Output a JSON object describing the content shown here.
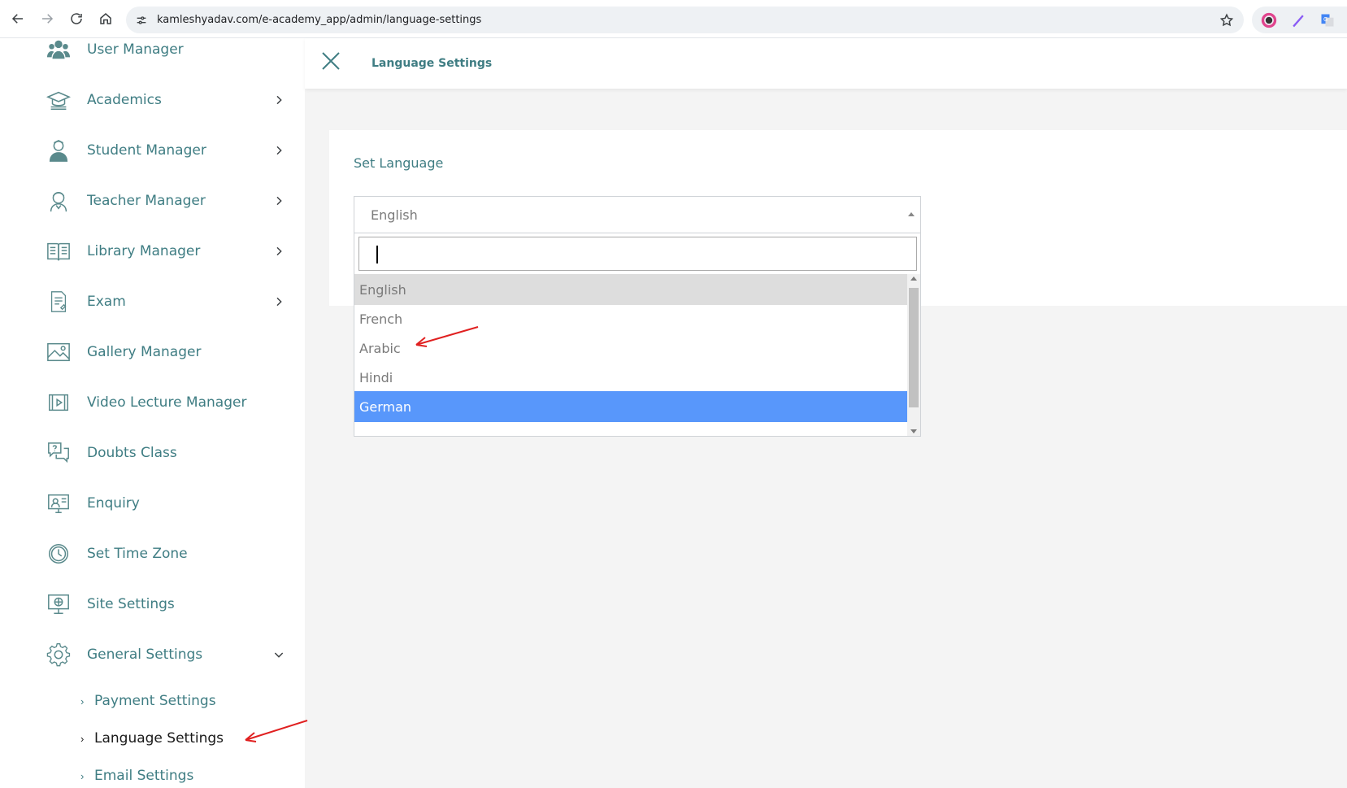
{
  "browser": {
    "url": "kamleshyadav.com/e-academy_app/admin/language-settings"
  },
  "sidebar": {
    "items": [
      {
        "label": "User Manager",
        "icon": "users-icon",
        "has_chevron": false
      },
      {
        "label": "Academics",
        "icon": "graduation-cap-icon",
        "has_chevron": true
      },
      {
        "label": "Student Manager",
        "icon": "student-icon",
        "has_chevron": true
      },
      {
        "label": "Teacher Manager",
        "icon": "teacher-icon",
        "has_chevron": true
      },
      {
        "label": "Library Manager",
        "icon": "book-icon",
        "has_chevron": true
      },
      {
        "label": "Exam",
        "icon": "exam-sheet-icon",
        "has_chevron": true
      },
      {
        "label": "Gallery Manager",
        "icon": "image-icon",
        "has_chevron": false
      },
      {
        "label": "Video Lecture Manager",
        "icon": "video-icon",
        "has_chevron": false
      },
      {
        "label": "Doubts Class",
        "icon": "chat-question-icon",
        "has_chevron": false
      },
      {
        "label": "Enquiry",
        "icon": "enquiry-icon",
        "has_chevron": false
      },
      {
        "label": "Set Time Zone",
        "icon": "clock-icon",
        "has_chevron": false
      },
      {
        "label": "Site Settings",
        "icon": "monitor-globe-icon",
        "has_chevron": false
      },
      {
        "label": "General Settings",
        "icon": "gear-icon",
        "has_chevron": true,
        "expanded": true
      }
    ],
    "sub_items": [
      {
        "label": "Payment Settings",
        "active": false
      },
      {
        "label": "Language Settings",
        "active": true
      },
      {
        "label": "Email Settings",
        "active": false
      }
    ]
  },
  "header": {
    "title": "Language Settings"
  },
  "card": {
    "title": "Set Language",
    "select_value": "English",
    "search_value": "",
    "options": [
      "English",
      "French",
      "Arabic",
      "Hindi",
      "German"
    ],
    "current_option": "English",
    "highlighted_option": "German"
  },
  "colors": {
    "accent": "#3f7d83",
    "highlight": "#5897fb",
    "annotation": "#e02020"
  }
}
